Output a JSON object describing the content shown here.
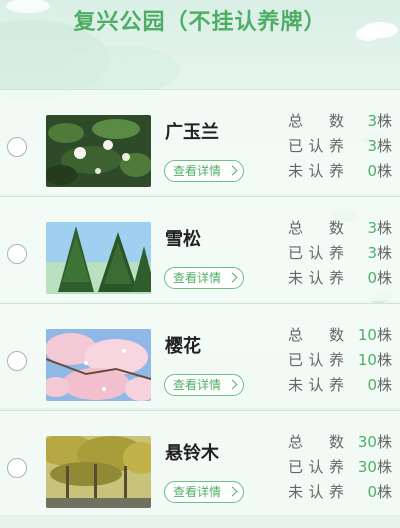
{
  "page": {
    "title": "复兴公园（不挂认养牌）"
  },
  "colors": {
    "accent": "#4fae66",
    "text": "#222222",
    "muted": "#666666"
  },
  "unit": "株",
  "detail_label": "查看详情",
  "stat_labels": {
    "total": "总　数",
    "adopted": "已认养",
    "unadopted": "未认养"
  },
  "items": [
    {
      "name": "广玉兰",
      "image": "magnolia-photo",
      "total": "3",
      "adopted": "3",
      "unadopted": "0"
    },
    {
      "name": "雪松",
      "image": "cedar-photo",
      "total": "3",
      "adopted": "3",
      "unadopted": "0"
    },
    {
      "name": "樱花",
      "image": "cherry-blossom-photo",
      "total": "10",
      "adopted": "10",
      "unadopted": "0"
    },
    {
      "name": "悬铃木",
      "image": "plane-tree-photo",
      "total": "30",
      "adopted": "30",
      "unadopted": "0"
    }
  ]
}
